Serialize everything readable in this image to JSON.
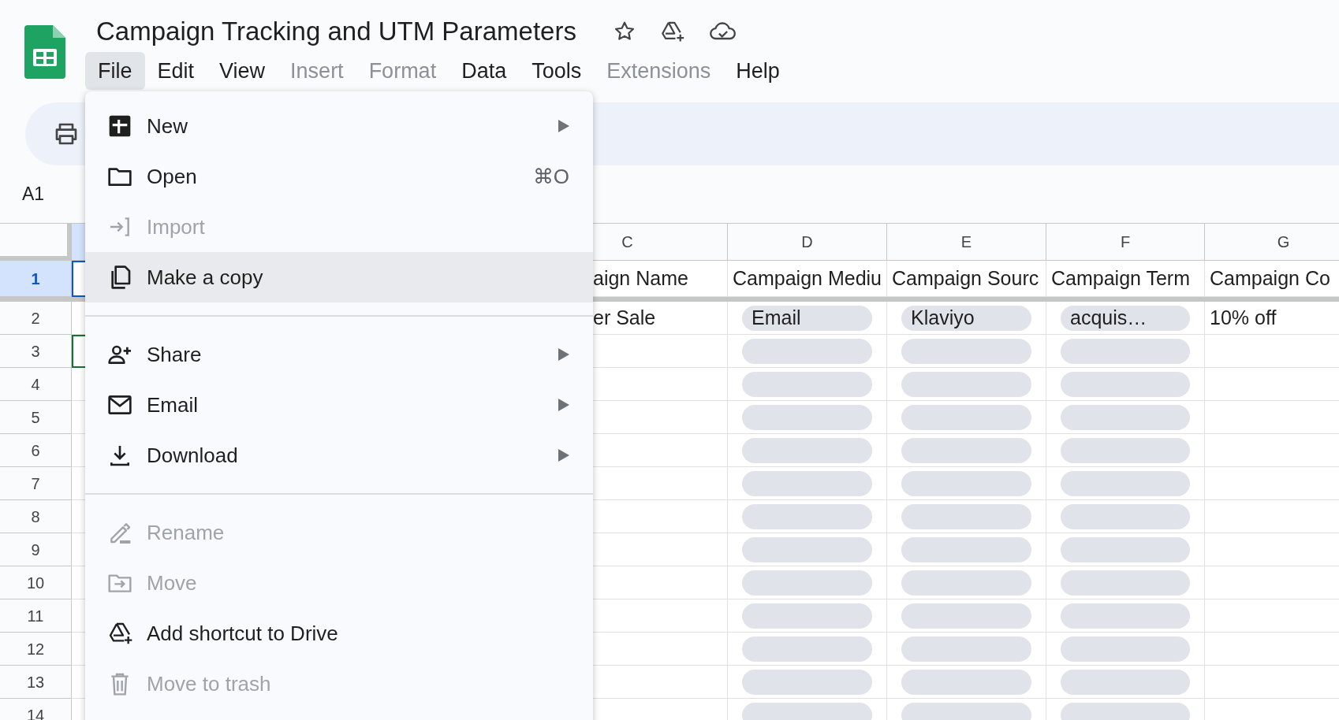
{
  "document": {
    "title": "Campaign Tracking and UTM Parameters"
  },
  "menu_bar": [
    {
      "label": "File",
      "selected": true,
      "disabled": false
    },
    {
      "label": "Edit",
      "selected": false,
      "disabled": false
    },
    {
      "label": "View",
      "selected": false,
      "disabled": false
    },
    {
      "label": "Insert",
      "selected": false,
      "disabled": true
    },
    {
      "label": "Format",
      "selected": false,
      "disabled": true
    },
    {
      "label": "Data",
      "selected": false,
      "disabled": false
    },
    {
      "label": "Tools",
      "selected": false,
      "disabled": false
    },
    {
      "label": "Extensions",
      "selected": false,
      "disabled": true
    },
    {
      "label": "Help",
      "selected": false,
      "disabled": false
    }
  ],
  "name_box": "A1",
  "file_menu": [
    {
      "kind": "item",
      "label": "New",
      "submenu": true,
      "disabled": false,
      "hovered": false
    },
    {
      "kind": "item",
      "label": "Open",
      "shortcut": "⌘O",
      "submenu": false,
      "disabled": false,
      "hovered": false
    },
    {
      "kind": "item",
      "label": "Import",
      "submenu": false,
      "disabled": true,
      "hovered": false
    },
    {
      "kind": "item",
      "label": "Make a copy",
      "submenu": false,
      "disabled": false,
      "hovered": true
    },
    {
      "kind": "separator"
    },
    {
      "kind": "item",
      "label": "Share",
      "submenu": true,
      "disabled": false,
      "hovered": false
    },
    {
      "kind": "item",
      "label": "Email",
      "submenu": true,
      "disabled": false,
      "hovered": false
    },
    {
      "kind": "item",
      "label": "Download",
      "submenu": true,
      "disabled": false,
      "hovered": false
    },
    {
      "kind": "separator"
    },
    {
      "kind": "item",
      "label": "Rename",
      "submenu": false,
      "disabled": true,
      "hovered": false
    },
    {
      "kind": "item",
      "label": "Move",
      "submenu": false,
      "disabled": true,
      "hovered": false
    },
    {
      "kind": "item",
      "label": "Add shortcut to Drive",
      "submenu": false,
      "disabled": false,
      "hovered": false
    },
    {
      "kind": "item",
      "label": "Move to trash",
      "submenu": false,
      "disabled": true,
      "hovered": false
    }
  ],
  "sheet": {
    "columns": [
      {
        "selected": true
      },
      {
        "label": "C",
        "selected": false
      },
      {
        "label": "D",
        "selected": false
      },
      {
        "label": "E",
        "selected": false
      },
      {
        "label": "F",
        "selected": false
      },
      {
        "label": "G",
        "selected": false
      }
    ],
    "header_row": {
      "number": "1",
      "selected": true,
      "cells": [
        "",
        "aign Name",
        "Campaign Mediu",
        "Campaign Sourc",
        "Campaign Term",
        "Campaign Co"
      ]
    },
    "rows": [
      {
        "number": "2",
        "cells": [
          {
            "kind": "blank",
            "outlined": false
          },
          {
            "kind": "text",
            "text": "er Sale"
          },
          {
            "kind": "chip",
            "text": "Email"
          },
          {
            "kind": "chip",
            "text": "Klaviyo"
          },
          {
            "kind": "chip",
            "text": "acquis…"
          },
          {
            "kind": "text",
            "text": "10% off"
          }
        ]
      },
      {
        "number": "3",
        "cells": [
          {
            "kind": "blank",
            "outlined": true
          },
          {
            "kind": "blank"
          },
          {
            "kind": "chip"
          },
          {
            "kind": "chip"
          },
          {
            "kind": "chip"
          },
          {
            "kind": "blank"
          }
        ]
      },
      {
        "number": "4",
        "cells": [
          {
            "kind": "blank",
            "outlined": false
          },
          {
            "kind": "blank"
          },
          {
            "kind": "chip"
          },
          {
            "kind": "chip"
          },
          {
            "kind": "chip"
          },
          {
            "kind": "blank"
          }
        ]
      },
      {
        "number": "5",
        "cells": [
          {
            "kind": "blank",
            "outlined": false
          },
          {
            "kind": "blank"
          },
          {
            "kind": "chip"
          },
          {
            "kind": "chip"
          },
          {
            "kind": "chip"
          },
          {
            "kind": "blank"
          }
        ]
      },
      {
        "number": "6",
        "cells": [
          {
            "kind": "blank",
            "outlined": false
          },
          {
            "kind": "blank"
          },
          {
            "kind": "chip"
          },
          {
            "kind": "chip"
          },
          {
            "kind": "chip"
          },
          {
            "kind": "blank"
          }
        ]
      },
      {
        "number": "7",
        "cells": [
          {
            "kind": "blank",
            "outlined": false
          },
          {
            "kind": "blank"
          },
          {
            "kind": "chip"
          },
          {
            "kind": "chip"
          },
          {
            "kind": "chip"
          },
          {
            "kind": "blank"
          }
        ]
      },
      {
        "number": "8",
        "cells": [
          {
            "kind": "blank",
            "outlined": false
          },
          {
            "kind": "blank"
          },
          {
            "kind": "chip"
          },
          {
            "kind": "chip"
          },
          {
            "kind": "chip"
          },
          {
            "kind": "blank"
          }
        ]
      },
      {
        "number": "9",
        "cells": [
          {
            "kind": "blank",
            "outlined": false
          },
          {
            "kind": "blank"
          },
          {
            "kind": "chip"
          },
          {
            "kind": "chip"
          },
          {
            "kind": "chip"
          },
          {
            "kind": "blank"
          }
        ]
      },
      {
        "number": "10",
        "cells": [
          {
            "kind": "blank",
            "outlined": false
          },
          {
            "kind": "blank"
          },
          {
            "kind": "chip"
          },
          {
            "kind": "chip"
          },
          {
            "kind": "chip"
          },
          {
            "kind": "blank"
          }
        ]
      },
      {
        "number": "11",
        "cells": [
          {
            "kind": "blank",
            "outlined": false
          },
          {
            "kind": "blank"
          },
          {
            "kind": "chip"
          },
          {
            "kind": "chip"
          },
          {
            "kind": "chip"
          },
          {
            "kind": "blank"
          }
        ]
      },
      {
        "number": "12",
        "cells": [
          {
            "kind": "blank",
            "outlined": false
          },
          {
            "kind": "blank"
          },
          {
            "kind": "chip"
          },
          {
            "kind": "chip"
          },
          {
            "kind": "chip"
          },
          {
            "kind": "blank"
          }
        ]
      },
      {
        "number": "13",
        "cells": [
          {
            "kind": "blank",
            "outlined": false
          },
          {
            "kind": "blank"
          },
          {
            "kind": "chip"
          },
          {
            "kind": "chip"
          },
          {
            "kind": "chip"
          },
          {
            "kind": "blank"
          }
        ]
      },
      {
        "number": "14",
        "cells": [
          {
            "kind": "blank",
            "outlined": false
          },
          {
            "kind": "blank"
          },
          {
            "kind": "chip"
          },
          {
            "kind": "chip"
          },
          {
            "kind": "chip"
          },
          {
            "kind": "blank"
          }
        ]
      }
    ]
  }
}
